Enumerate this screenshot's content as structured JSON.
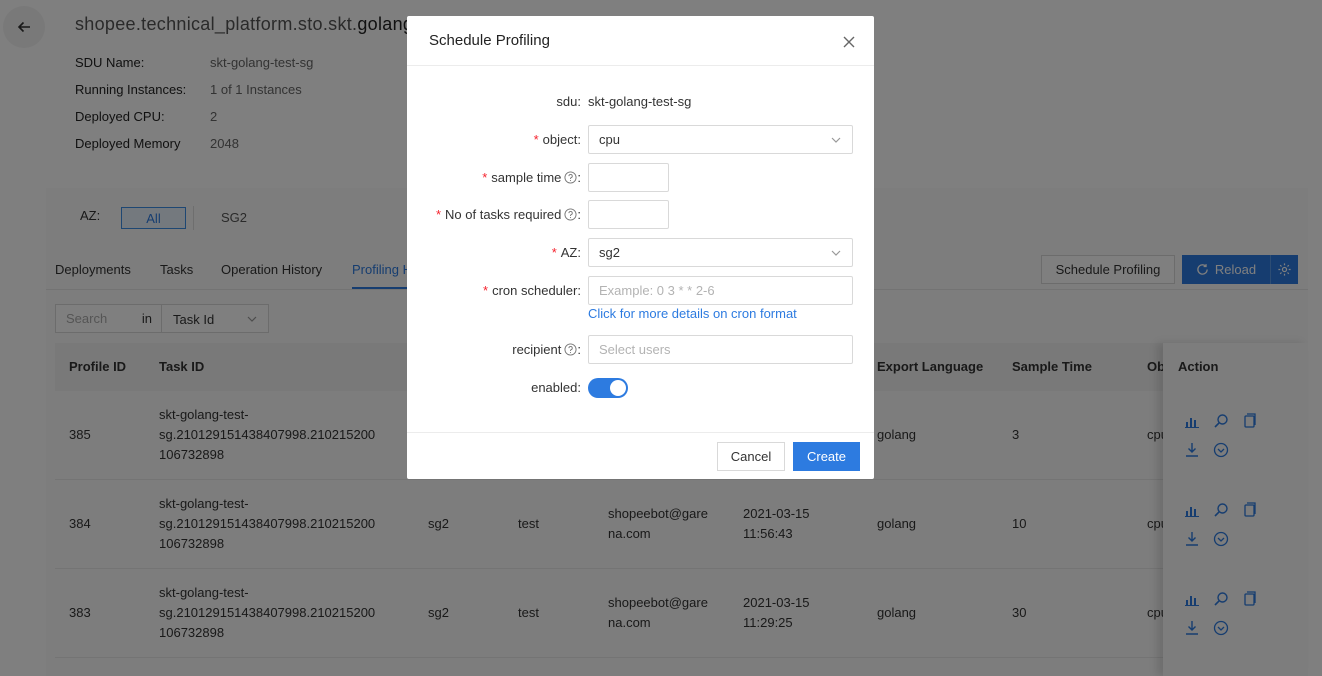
{
  "header": {
    "title_prefix": "shopee.technical_platform.sto.skt.",
    "title_suffix": "golang"
  },
  "info": [
    {
      "key": "SDU Name:",
      "value": "skt-golang-test-sg"
    },
    {
      "key": "Running Instances:",
      "value": "1 of 1 Instances"
    },
    {
      "key": "Deployed CPU:",
      "value": "2"
    },
    {
      "key": "Deployed Memory",
      "value": "2048"
    }
  ],
  "az": {
    "label": "AZ:",
    "all": "All",
    "sg2": "SG2"
  },
  "tabs": [
    "Deployments",
    "Tasks",
    "Operation History",
    "Profiling H"
  ],
  "toolbar": {
    "schedule_label": "Schedule Profiling",
    "reload_label": "Reload"
  },
  "filter": {
    "search_placeholder": "Search",
    "in_label": "in",
    "field_value": "Task Id"
  },
  "table": {
    "headers": {
      "profile_id": "Profile ID",
      "task_id": "Task ID",
      "export_language": "Export Language",
      "sample_time": "Sample Time",
      "object": "Ob",
      "action": "Action"
    },
    "rows": [
      {
        "profile_id": "385",
        "task_line1": "skt-golang-test-",
        "task_line2": "sg.210129151438407998.210215200",
        "task_line3": "106732898",
        "az": "",
        "env": "",
        "user1": "",
        "user2": "",
        "date": "",
        "time": "",
        "lang": "golang",
        "sample": "3",
        "obj": "cpu"
      },
      {
        "profile_id": "384",
        "task_line1": "skt-golang-test-",
        "task_line2": "sg.210129151438407998.210215200",
        "task_line3": "106732898",
        "az": "sg2",
        "env": "test",
        "user1": "shopeebot@gare",
        "user2": "na.com",
        "date": "2021-03-15",
        "time": "11:56:43",
        "lang": "golang",
        "sample": "10",
        "obj": "cpu"
      },
      {
        "profile_id": "383",
        "task_line1": "skt-golang-test-",
        "task_line2": "sg.210129151438407998.210215200",
        "task_line3": "106732898",
        "az": "sg2",
        "env": "test",
        "user1": "shopeebot@gare",
        "user2": "na.com",
        "date": "2021-03-15",
        "time": "11:29:25",
        "lang": "golang",
        "sample": "30",
        "obj": "cpu"
      }
    ]
  },
  "modal": {
    "title": "Schedule Profiling",
    "sdu_label": "sdu",
    "sdu_value": "skt-golang-test-sg",
    "object_label": "object",
    "object_value": "cpu",
    "sample_time_label": "sample time",
    "sample_time_value": "",
    "tasks_label": "No of tasks required",
    "tasks_value": "",
    "az_label": "AZ",
    "az_value": "sg2",
    "cron_label": "cron scheduler",
    "cron_placeholder": "Example: 0 3 * * 2-6",
    "cron_link": "Click for more details on cron format",
    "recipient_label": "recipient",
    "recipient_placeholder": "Select users",
    "enabled_label": "enabled",
    "enabled": true,
    "colon": ":",
    "required_mark": "*",
    "cancel_label": "Cancel",
    "create_label": "Create"
  },
  "colors": {
    "accent": "#2d7be0",
    "required": "#f5222d",
    "overlay": "rgba(0,0,0,0.5)"
  }
}
